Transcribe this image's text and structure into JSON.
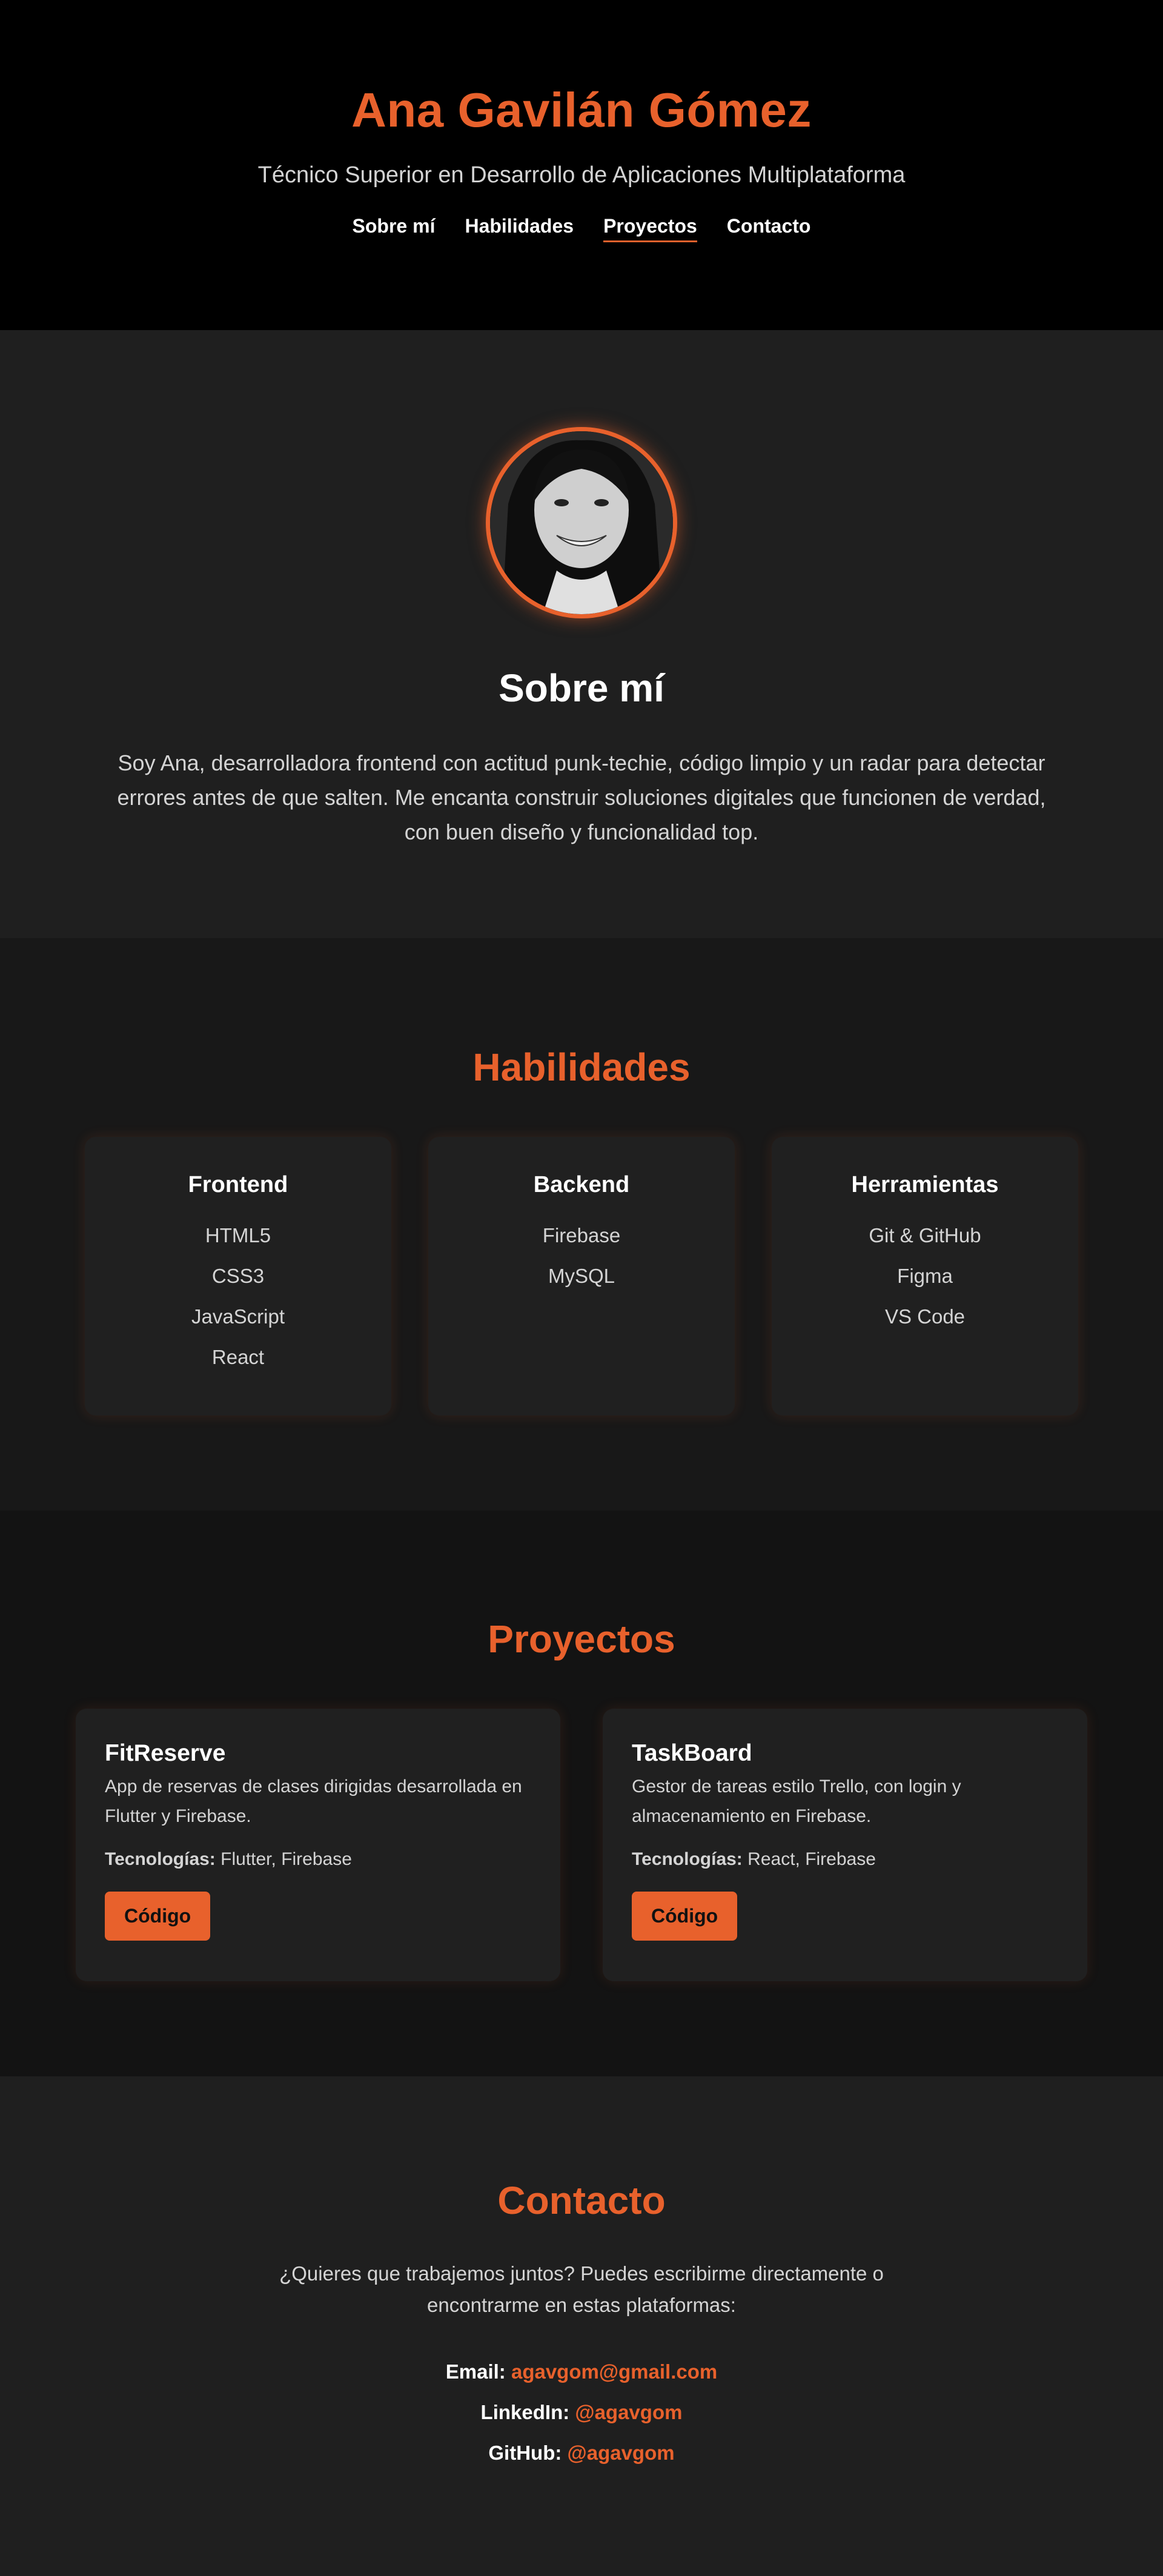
{
  "header": {
    "name": "Ana Gavilán Gómez",
    "subtitle": "Técnico Superior en Desarrollo de Aplicaciones Multiplataforma",
    "nav": [
      {
        "label": "Sobre mí",
        "active": false
      },
      {
        "label": "Habilidades",
        "active": false
      },
      {
        "label": "Proyectos",
        "active": true
      },
      {
        "label": "Contacto",
        "active": false
      }
    ]
  },
  "about": {
    "title": "Sobre mí",
    "text": "Soy Ana, desarrolladora frontend con actitud punk-techie, código limpio y un radar para detectar errores antes de que salten. Me encanta construir soluciones digitales que funcionen de verdad, con buen diseño y funcionalidad top."
  },
  "skills": {
    "title": "Habilidades",
    "cards": [
      {
        "title": "Frontend",
        "items": [
          "HTML5",
          "CSS3",
          "JavaScript",
          "React"
        ]
      },
      {
        "title": "Backend",
        "items": [
          "Firebase",
          "MySQL"
        ]
      },
      {
        "title": "Herramientas",
        "items": [
          "Git & GitHub",
          "Figma",
          "VS Code"
        ]
      }
    ]
  },
  "projects": {
    "title": "Proyectos",
    "cards": [
      {
        "title": "FitReserve",
        "desc": "App de reservas de clases dirigidas desarrollada en Flutter y Firebase.",
        "tech_label": "Tecnologías:",
        "tech": "Flutter, Firebase",
        "button": "Código"
      },
      {
        "title": "TaskBoard",
        "desc": "Gestor de tareas estilo Trello, con login y almacenamiento en Firebase.",
        "tech_label": "Tecnologías:",
        "tech": "React, Firebase",
        "button": "Código"
      }
    ]
  },
  "contact": {
    "title": "Contacto",
    "intro": "¿Quieres que trabajemos juntos? Puedes escribirme directamente o encontrarme en estas plataformas:",
    "items": [
      {
        "label": "Email:",
        "value": "agavgom@gmail.com"
      },
      {
        "label": "LinkedIn:",
        "value": "@agavgom"
      },
      {
        "label": "GitHub:",
        "value": "@agavgom"
      }
    ]
  },
  "colors": {
    "accent": "#e8612c",
    "bg_dark": "#000000",
    "bg_section": "#1f1f1f",
    "card": "#202020"
  }
}
